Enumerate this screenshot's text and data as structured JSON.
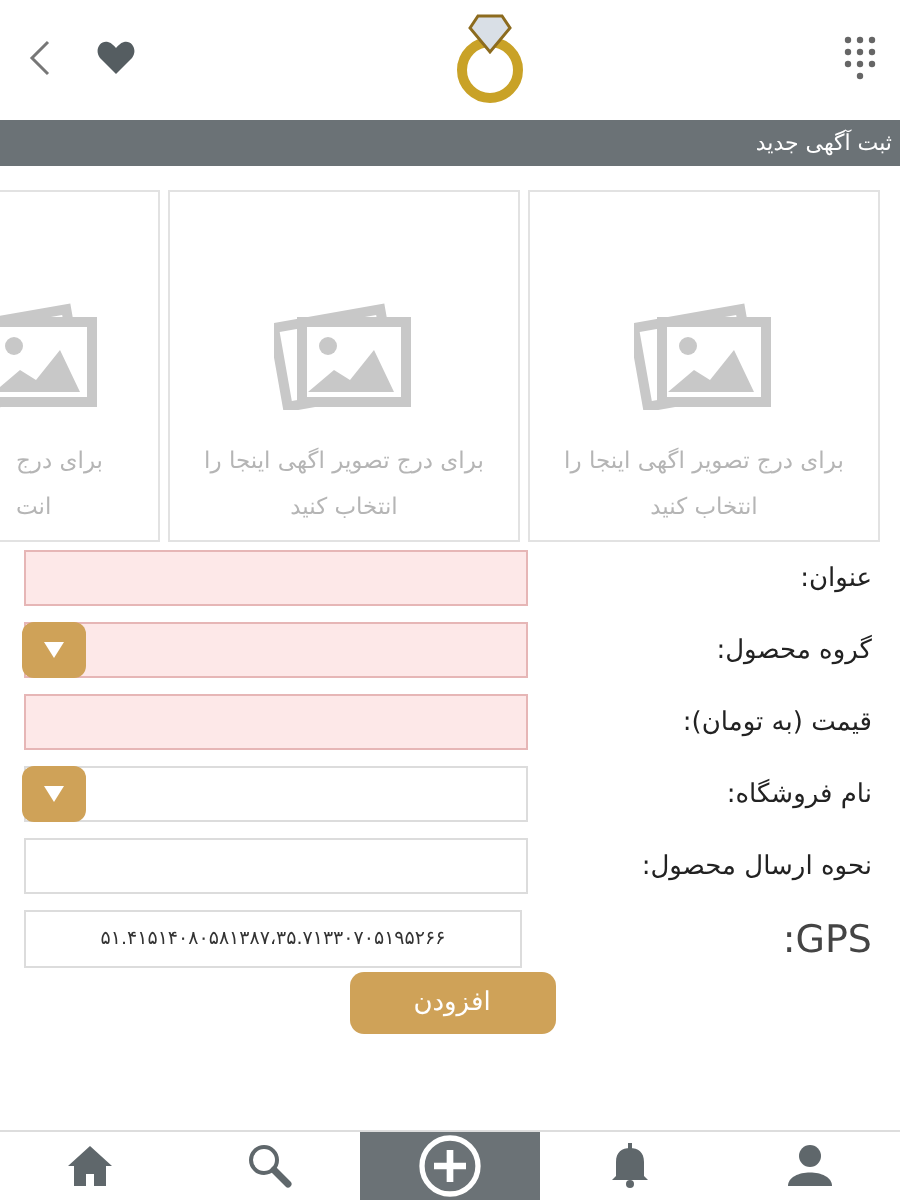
{
  "header": {
    "title": "ثبت آگهی جدید"
  },
  "image_slots": [
    {
      "lines": [
        "برای درج تصویر اگهی اینجا را",
        "انتخاب کنید"
      ],
      "cut": false
    },
    {
      "lines": [
        "برای درج تصویر اگهی اینجا را",
        "انتخاب کنید"
      ],
      "cut": false
    },
    {
      "lines": [
        "برای درج",
        "انت"
      ],
      "cut": true
    }
  ],
  "fields": [
    {
      "label": "عنوان:",
      "kind": "text",
      "invalid": true
    },
    {
      "label": "گروه محصول:",
      "kind": "select",
      "invalid": true
    },
    {
      "label": "قیمت (به تومان):",
      "kind": "text",
      "invalid": true
    },
    {
      "label": "نام فروشگاه:",
      "kind": "select",
      "invalid": false
    },
    {
      "label": "نحوه ارسال محصول:",
      "kind": "text",
      "invalid": false
    }
  ],
  "gps": {
    "label": ":GPS",
    "value": "۵۱.۴۱۵۱۴۰۸۰۵۸۱۳۸۷،۳۵.۷۱۳۳۰۷۰۵۱۹۵۲۶۶"
  },
  "submit": {
    "label": "افزودن"
  },
  "bottom_nav": [
    {
      "kind": "profile",
      "selected": false
    },
    {
      "kind": "bell",
      "selected": false
    },
    {
      "kind": "add",
      "selected": true
    },
    {
      "kind": "search",
      "selected": false
    },
    {
      "kind": "home",
      "selected": false
    }
  ]
}
